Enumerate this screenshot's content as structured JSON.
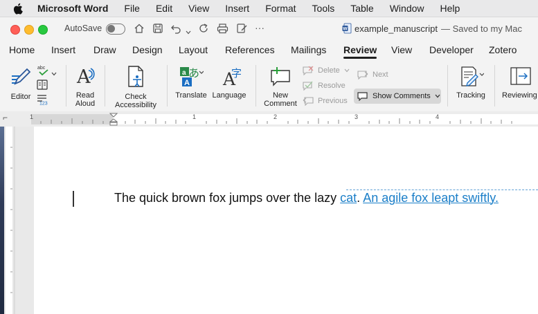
{
  "menubar": {
    "app": "Microsoft Word",
    "items": [
      "File",
      "Edit",
      "View",
      "Insert",
      "Format",
      "Tools",
      "Table",
      "Window",
      "Help"
    ]
  },
  "titlebar": {
    "autosave_label": "AutoSave",
    "doc_name": "example_manuscript",
    "doc_status": "— Saved to my Mac",
    "accent_color": "#2b579a"
  },
  "tabs": [
    "Home",
    "Insert",
    "Draw",
    "Design",
    "Layout",
    "References",
    "Mailings",
    "Review",
    "View",
    "Developer",
    "Zotero"
  ],
  "active_tab": "Review",
  "ribbon": {
    "editor": "Editor",
    "read_aloud": [
      "Read",
      "Aloud"
    ],
    "check_accessibility": [
      "Check",
      "Accessibility"
    ],
    "translate": "Translate",
    "language": "Language",
    "new_comment": [
      "New",
      "Comment"
    ],
    "delete": "Delete",
    "resolve": "Resolve",
    "previous": "Previous",
    "next": "Next",
    "show_comments": "Show Comments",
    "tracking": "Tracking",
    "reviewing": "Reviewing"
  },
  "ruler": {
    "marks": [
      "1",
      "1",
      "2",
      "3",
      "4"
    ]
  },
  "document": {
    "text_plain": "The quick brown fox jumps over the lazy ",
    "text_tracked_1": "cat",
    "text_sep": ". ",
    "text_tracked_2": "An agile fox leapt swiftly.",
    "tracked_color": "#1a7ec8"
  }
}
